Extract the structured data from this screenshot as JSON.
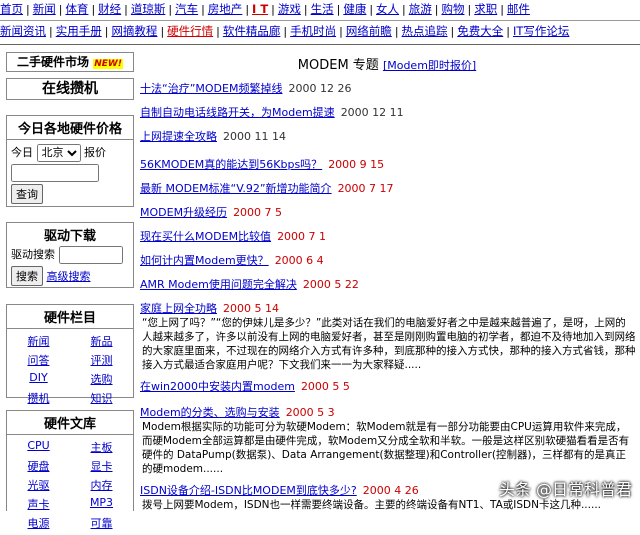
{
  "nav1": {
    "items": [
      "首页",
      "新闻",
      "体育",
      "财经",
      "道琼斯",
      "汽车",
      "房地产",
      "I T",
      "游戏",
      "生活",
      "健康",
      "女人",
      "旅游",
      "购物",
      "求职",
      "邮件"
    ],
    "hot_index": 7
  },
  "nav2": {
    "items": [
      "新闻资讯",
      "实用手册",
      "网摘教程",
      "硬件行情",
      "软件精品廊",
      "手机时尚",
      "网络前瞻",
      "热点追踪",
      "免费大全",
      "IT写作论坛"
    ],
    "hot_index": 3
  },
  "sidebar": {
    "market": {
      "label": "二手硬件市场",
      "badge": "NEW!"
    },
    "zone": {
      "label": "在线攒机"
    },
    "prices": {
      "title": "今日各地硬件价格",
      "today": "今日",
      "city": "北京",
      "quote": "报价",
      "button": "查询"
    },
    "drivers": {
      "title": "驱动下载",
      "label": "驱动搜索",
      "search_btn": "搜索",
      "advanced": "高级搜索"
    },
    "columns": {
      "title": "硬件栏目",
      "items": [
        "新闻",
        "新品",
        "问答",
        "评测",
        "DIY",
        "选购",
        "攒机",
        "知识"
      ]
    },
    "library": {
      "title": "硬件文库",
      "items": [
        "CPU",
        "主板",
        "硬盘",
        "显卡",
        "光驱",
        "内存",
        "声卡",
        "MP3",
        "电源",
        "可靠"
      ]
    }
  },
  "main": {
    "title": "MODEM 专题",
    "title_link": "[Modem即时报价]",
    "articles": [
      {
        "title": "十法“治疗”MODEM频繁掉线",
        "date": "2000 12 26",
        "red": false
      },
      {
        "title": "自制自动电话线路开关，为Modem提速",
        "date": "2000 12 11",
        "red": false
      },
      {
        "title": "上网提速全攻略",
        "date": "2000 11 14",
        "red": false
      },
      {
        "title": "56KMODEM真的能达到56Kbps吗？",
        "date": "2000 9 15",
        "red": true
      },
      {
        "title": "最新 MODEM标准“V.92”新增功能简介",
        "date": "2000 7 17",
        "red": true
      },
      {
        "title": "MODEM升级经历",
        "date": "2000 7 5",
        "red": true
      },
      {
        "title": "现在买什么MODEM比较值",
        "date": "2000 7 1",
        "red": true
      },
      {
        "title": "如何计内置Modem更快？",
        "date": "2000 6 4",
        "red": true
      },
      {
        "title": "AMR Modem使用问题完全解决",
        "date": "2000 5 22",
        "red": true
      },
      {
        "title": "家庭上网全功略",
        "date": "2000 5 14",
        "red": true,
        "desc": "“您上网了吗？”“您的伊妹儿是多少？”此类对话在我们的电脑爱好者之中是越来越普遍了，是呀，上网的人越来越多了，许多以前没有上网的电脑爱好者，甚至是刚刚购置电脑的初学者，都迫不及待地加入到网络的大家庭里面来，不过现在的网络介入方式有许多种，到底那种的接入方式快，那种的接入方式省钱，那种接入方式最适合家庭用户呢？下文我们来一一为大家释疑....."
      },
      {
        "title": "在win2000中安装内置modem",
        "date": "2000 5 5",
        "red": true
      },
      {
        "title": "Modem的分类、选购与安装",
        "date": "2000 5 3",
        "red": true,
        "desc": "Modem根据实际的功能可分为软硬Modem：软Modem就是有一部分功能要由CPU运算用软件来完成，而硬Modem全部运算都是由硬件完成，软Modem又分成全软和半软。一般是这样区别软硬猫看看是否有硬件的 DataPump(数据泵)、Data Arrangement(数据整理)和Controller(控制器)，三样都有的是真正的硬modem......"
      },
      {
        "title": "ISDN设备介绍-ISDN比MODEM到底快多少?",
        "date": "2000 4 26",
        "red": true,
        "desc": "拨号上网要Modem，ISDN也一样需要终端设备。主要的终端设备有NT1、TA或ISDN卡这几种......"
      }
    ]
  },
  "watermark": "头条 @日常科普君"
}
